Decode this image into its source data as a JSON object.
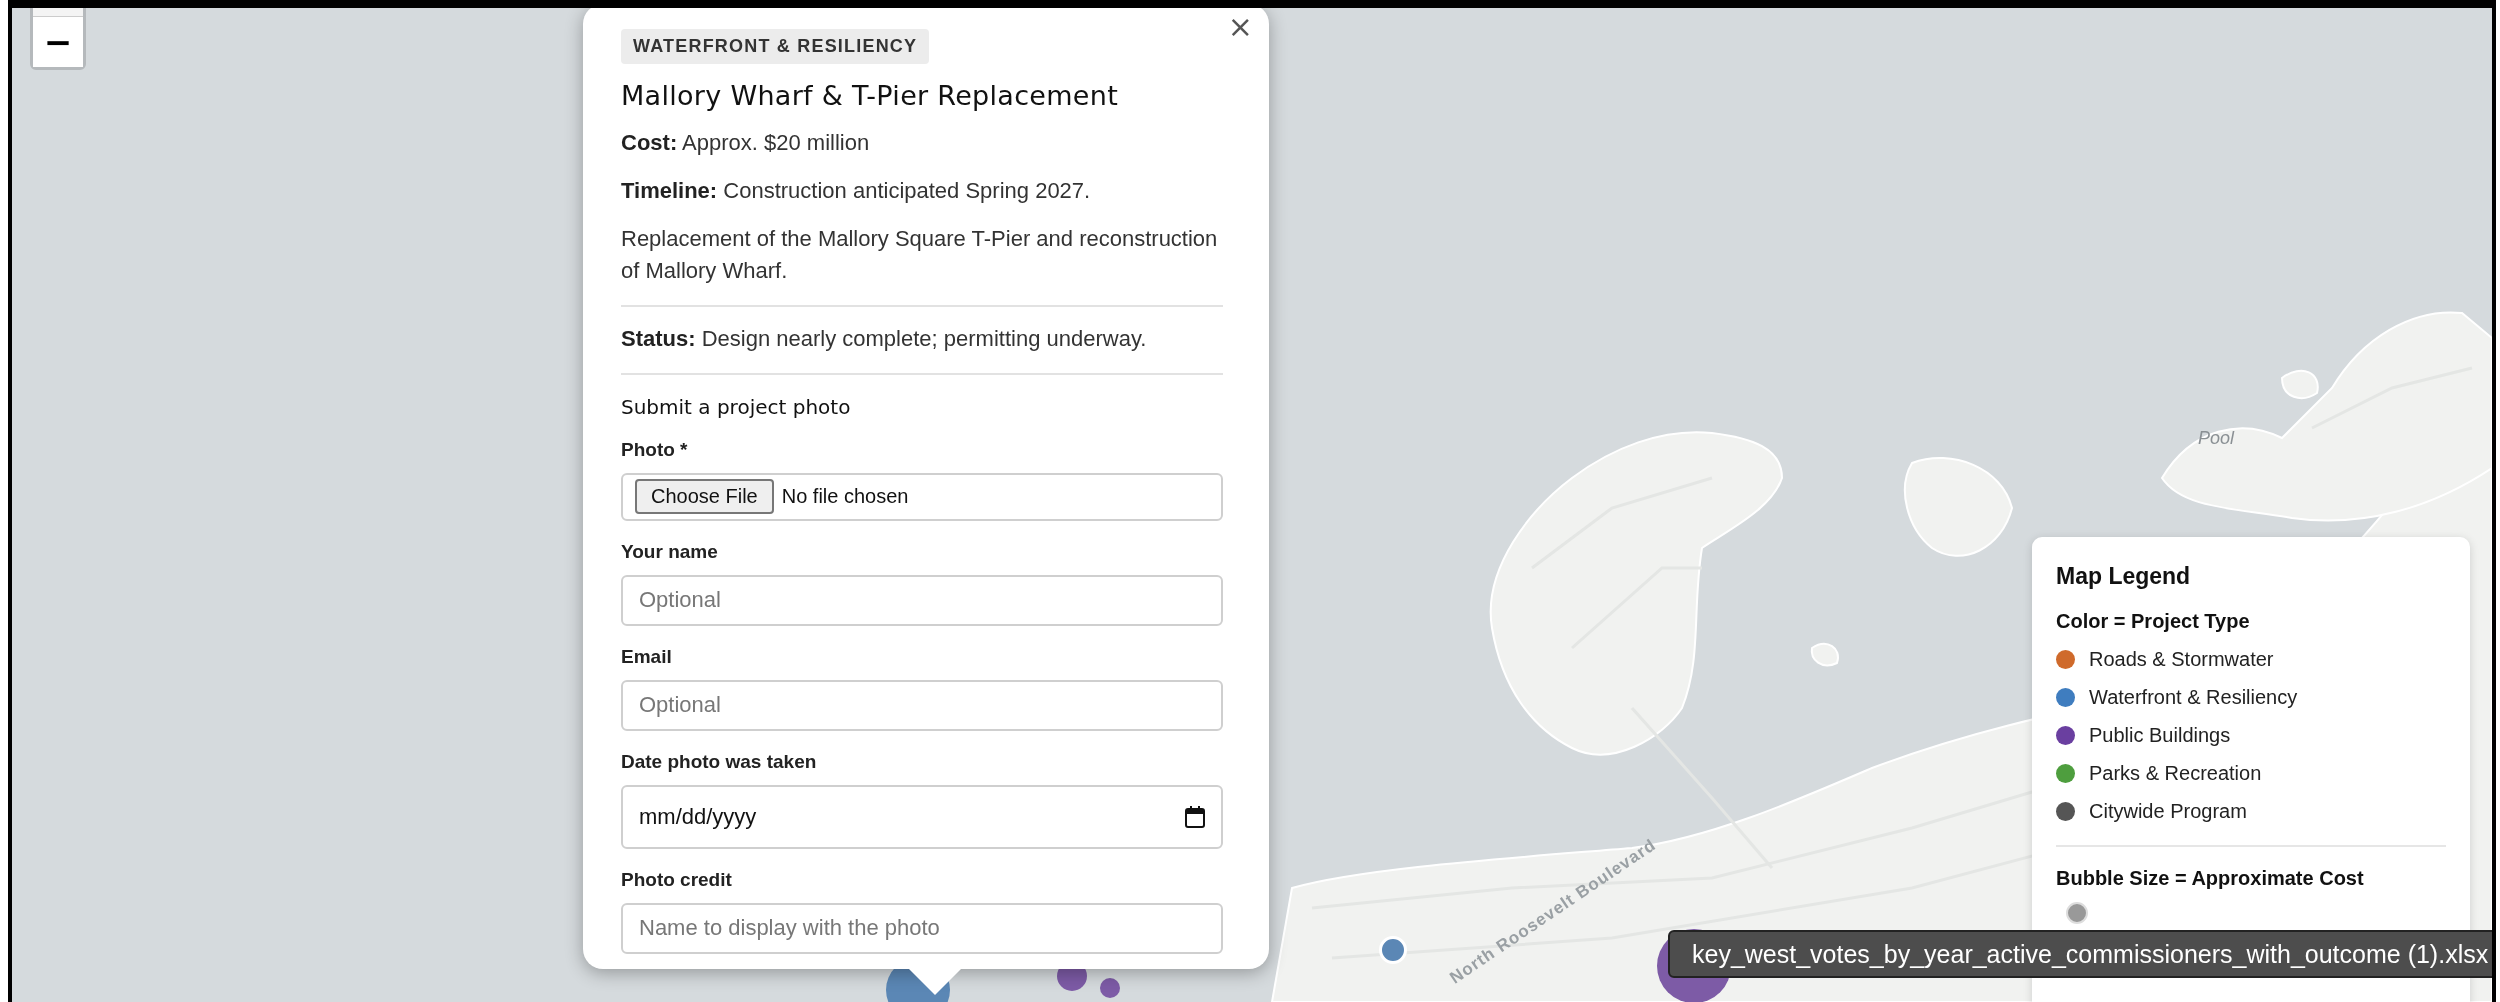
{
  "map": {
    "labels": [
      {
        "kind": "place",
        "text": "Pool"
      },
      {
        "kind": "road",
        "text": "North Roosevelt Boulevard"
      }
    ],
    "bubbles": [
      {
        "color": "#5b87b5"
      },
      {
        "color": "#7d5ba6"
      },
      {
        "color": "#7d5ba6"
      },
      {
        "color": "#5b87b5"
      },
      {
        "color": "#7d5ba6"
      }
    ]
  },
  "zoom_control": {
    "zoom_out": "−"
  },
  "popup": {
    "close": "×",
    "category": "WATERFRONT & RESILIENCY",
    "title": "Mallory Wharf & T-Pier Replacement",
    "details": [
      "**Cost:** Approx. $20 million",
      "**Timeline:** Construction anticipated Spring 2027.",
      "Replacement of the Mallory Square T-Pier and reconstruction of Mallory Wharf."
    ],
    "status": "**Status:** Design nearly complete; permitting underway.",
    "form": {
      "heading": "Submit a project photo",
      "fields": [
        {
          "kind": "file",
          "label": "Photo *",
          "button": "Choose File",
          "value": "No file chosen"
        },
        {
          "kind": "text",
          "label": "Your name",
          "placeholder": "Optional"
        },
        {
          "kind": "text",
          "label": "Email",
          "placeholder": "Optional"
        },
        {
          "kind": "date",
          "label": "Date photo was taken",
          "value": "mm/dd/yyyy"
        },
        {
          "kind": "text",
          "label": "Photo credit",
          "placeholder": "Name to display with the photo"
        }
      ]
    }
  },
  "legend": {
    "title": "Map Legend",
    "color_heading": "Color = Project Type",
    "types": [
      {
        "label": "Roads & Stormwater",
        "color": "#cf6a2b"
      },
      {
        "label": "Waterfront & Resiliency",
        "color": "#3f7dbf"
      },
      {
        "label": "Public Buildings",
        "color": "#6a3fa0"
      },
      {
        "label": "Parks & Recreation",
        "color": "#4e9e3e"
      },
      {
        "label": "Citywide Program",
        "color": "#555555"
      }
    ],
    "size_heading": "Bubble Size = Approximate Cost"
  },
  "tooltip": "key_west_votes_by_year_active_commissioners_with_outcome (1).xlsx"
}
